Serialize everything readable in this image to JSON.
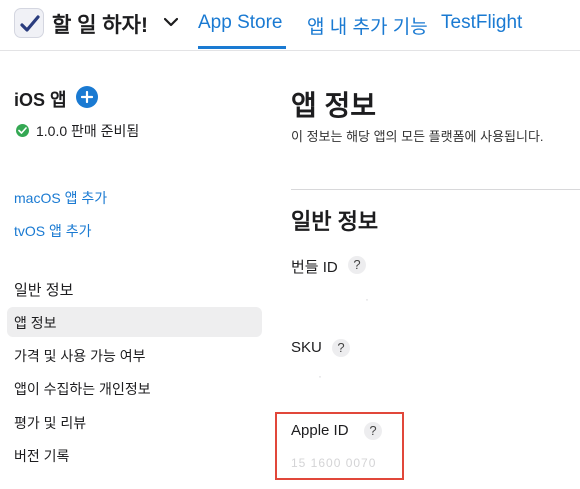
{
  "header": {
    "app_name": "할 일 하자!",
    "tabs": [
      {
        "label": "App Store"
      },
      {
        "label": "앱 내 추가 기능"
      },
      {
        "label": "TestFlight"
      }
    ],
    "accent_color": "#1a7ad2"
  },
  "sidebar": {
    "platform_label": "iOS 앱",
    "version_status": "1.0.0 판매 준비됨",
    "add_platform_links": [
      "macOS 앱 추가",
      "tvOS 앱 추가"
    ],
    "section_title": "일반 정보",
    "items": [
      {
        "label": "앱 정보",
        "selected": true
      },
      {
        "label": "가격 및 사용 가능 여부"
      },
      {
        "label": "앱이 수집하는 개인정보"
      },
      {
        "label": "평가 및 리뷰"
      },
      {
        "label": "버전 기록"
      }
    ]
  },
  "main": {
    "title": "앱 정보",
    "description": "이 정보는 해당 앱의 모든 플랫폼에 사용됩니다.",
    "section_title": "일반 정보",
    "fields": [
      {
        "label": "번들 ID",
        "help": "?",
        "value": "·"
      },
      {
        "label": "SKU",
        "help": "?",
        "value": "·"
      },
      {
        "label": "Apple ID",
        "help": "?",
        "value": "15 1600 0070"
      }
    ],
    "highlight_color": "#e1473a"
  }
}
